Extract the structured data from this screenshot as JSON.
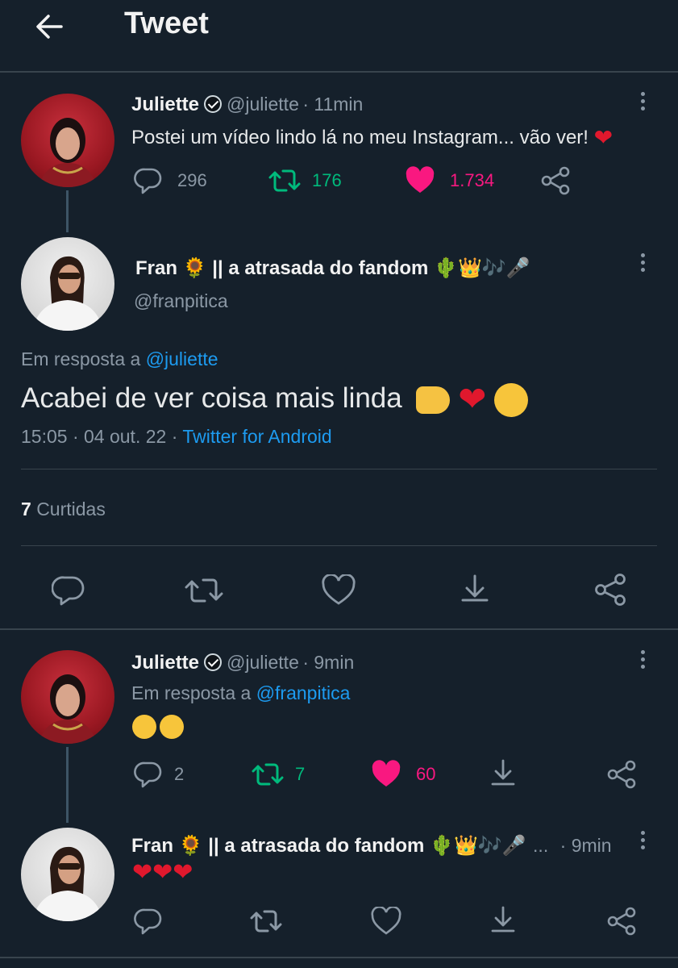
{
  "header": {
    "title": "Tweet"
  },
  "tweet1": {
    "name": "Juliette",
    "handle": "@juliette",
    "time": "· 11min",
    "text": "Postei um vídeo lindo lá no meu Instagram... vão ver!",
    "replies": "296",
    "retweets": "176",
    "likes": "1.734"
  },
  "main": {
    "name": "Fran 🌻 || a atrasada do fandom 🌵👑🎶🎤",
    "handle": "@franpitica",
    "reply_prefix": "Em resposta a",
    "reply_to": "@juliette",
    "text": "Acabei de ver coisa mais linda",
    "timestamp": "15:05 · 04 out. 22 ·",
    "source": "Twitter for Android",
    "likes_count": "7",
    "likes_label": "Curtidas"
  },
  "tweet3": {
    "name": "Juliette",
    "handle": "@juliette",
    "time": "· 9min",
    "reply_prefix": "Em resposta a",
    "reply_to": "@franpitica",
    "replies": "2",
    "retweets": "7",
    "likes": "60"
  },
  "tweet4": {
    "name": "Fran 🌻 || a atrasada do fandom 🌵👑🎶🎤",
    "ellipsis": "...",
    "time": "· 9min"
  },
  "colors": {
    "background": "#15202b",
    "link": "#1d9bf0",
    "retweet": "#00ba7c",
    "like": "#f91880",
    "muted": "#8b98a5"
  },
  "icons": [
    "back-arrow-icon",
    "verified-icon",
    "more-icon",
    "reply-icon",
    "retweet-icon",
    "like-icon",
    "share-icon",
    "bookmark-icon"
  ]
}
